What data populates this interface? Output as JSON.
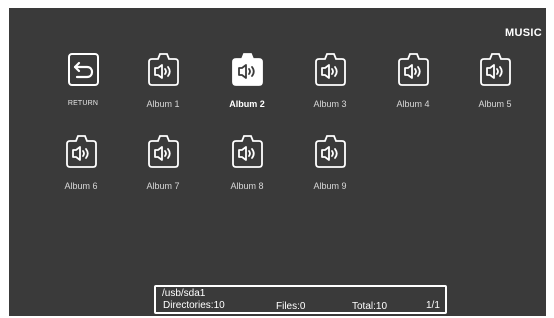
{
  "screen": {
    "title": "MUSIC"
  },
  "items": [
    {
      "label": "RETURN",
      "icon": "return-icon",
      "selected": false
    },
    {
      "label": "Album 1",
      "icon": "audio-folder-icon",
      "selected": false
    },
    {
      "label": "Album 2",
      "icon": "audio-folder-icon",
      "selected": true
    },
    {
      "label": "Album 3",
      "icon": "audio-folder-icon",
      "selected": false
    },
    {
      "label": "Album 4",
      "icon": "audio-folder-icon",
      "selected": false
    },
    {
      "label": "Album 5",
      "icon": "audio-folder-icon",
      "selected": false
    },
    {
      "label": "Album 6",
      "icon": "audio-folder-icon",
      "selected": false
    },
    {
      "label": "Album 7",
      "icon": "audio-folder-icon",
      "selected": false
    },
    {
      "label": "Album 8",
      "icon": "audio-folder-icon",
      "selected": false
    },
    {
      "label": "Album 9",
      "icon": "audio-folder-icon",
      "selected": false
    }
  ],
  "status": {
    "path": "/usb/sda1",
    "directories": "Directories:10",
    "files": "Files:0",
    "total": "Total:10",
    "page": "1/1"
  },
  "colors": {
    "background": "#3a3a3a",
    "text": "#ffffff",
    "selected_fill": "#ffffff"
  }
}
